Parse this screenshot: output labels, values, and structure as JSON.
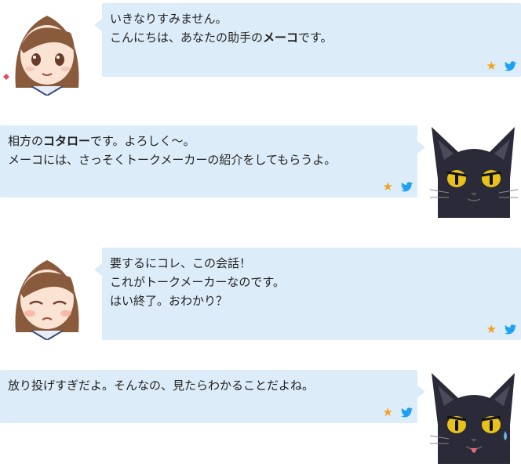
{
  "colors": {
    "bubble": "#dcecf8",
    "star": "#f0a21c",
    "twitter": "#1da1f2"
  },
  "icons": {
    "star": "★"
  },
  "messages": [
    {
      "speaker": "meko",
      "avatar": "girl-smile",
      "lines": [
        [
          {
            "text": "いきなりすみません。",
            "bold": false
          }
        ],
        [
          {
            "text": "こんにちは、あなたの助手の",
            "bold": false
          },
          {
            "text": "メーコ",
            "bold": true
          },
          {
            "text": "です。",
            "bold": false
          }
        ]
      ]
    },
    {
      "speaker": "kotaro",
      "avatar": "black-cat",
      "lines": [
        [
          {
            "text": "相方の",
            "bold": false
          },
          {
            "text": "コタロー",
            "bold": true
          },
          {
            "text": "です。よろしく～。",
            "bold": false
          }
        ],
        [
          {
            "text": "メーコには、さっそくトークメーカーの紹介をしてもらうよ。",
            "bold": false
          }
        ]
      ]
    },
    {
      "speaker": "meko",
      "avatar": "girl-eyes-closed",
      "lines": [
        [
          {
            "text": "要するにコレ、この会話！",
            "bold": false
          }
        ],
        [
          {
            "text": "これがトークメーカーなのです。",
            "bold": false
          }
        ],
        [
          {
            "text": "はい終了。おわかり？",
            "bold": false
          }
        ]
      ]
    },
    {
      "speaker": "kotaro",
      "avatar": "black-cat-sweat",
      "lines": [
        [
          {
            "text": "放り投げすぎだよ。そんなの、見たらわかることだよね。",
            "bold": false
          }
        ]
      ]
    }
  ]
}
